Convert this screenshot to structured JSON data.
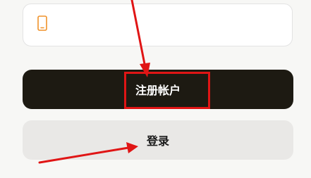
{
  "form": {
    "phone_field": {
      "icon": "phone-icon",
      "value": "",
      "placeholder": ""
    },
    "register_button": {
      "label": "注册帐户"
    },
    "login_button": {
      "label": "登录"
    }
  },
  "annotations": {
    "highlight": "register-button",
    "arrows_point_to": [
      "register-button",
      "login-button"
    ],
    "color": "#e01515"
  },
  "colors": {
    "background": "#f7f7f5",
    "primary_button": "#1d1a12",
    "secondary_button": "#e9e8e6",
    "icon_accent": "#f0922a"
  }
}
